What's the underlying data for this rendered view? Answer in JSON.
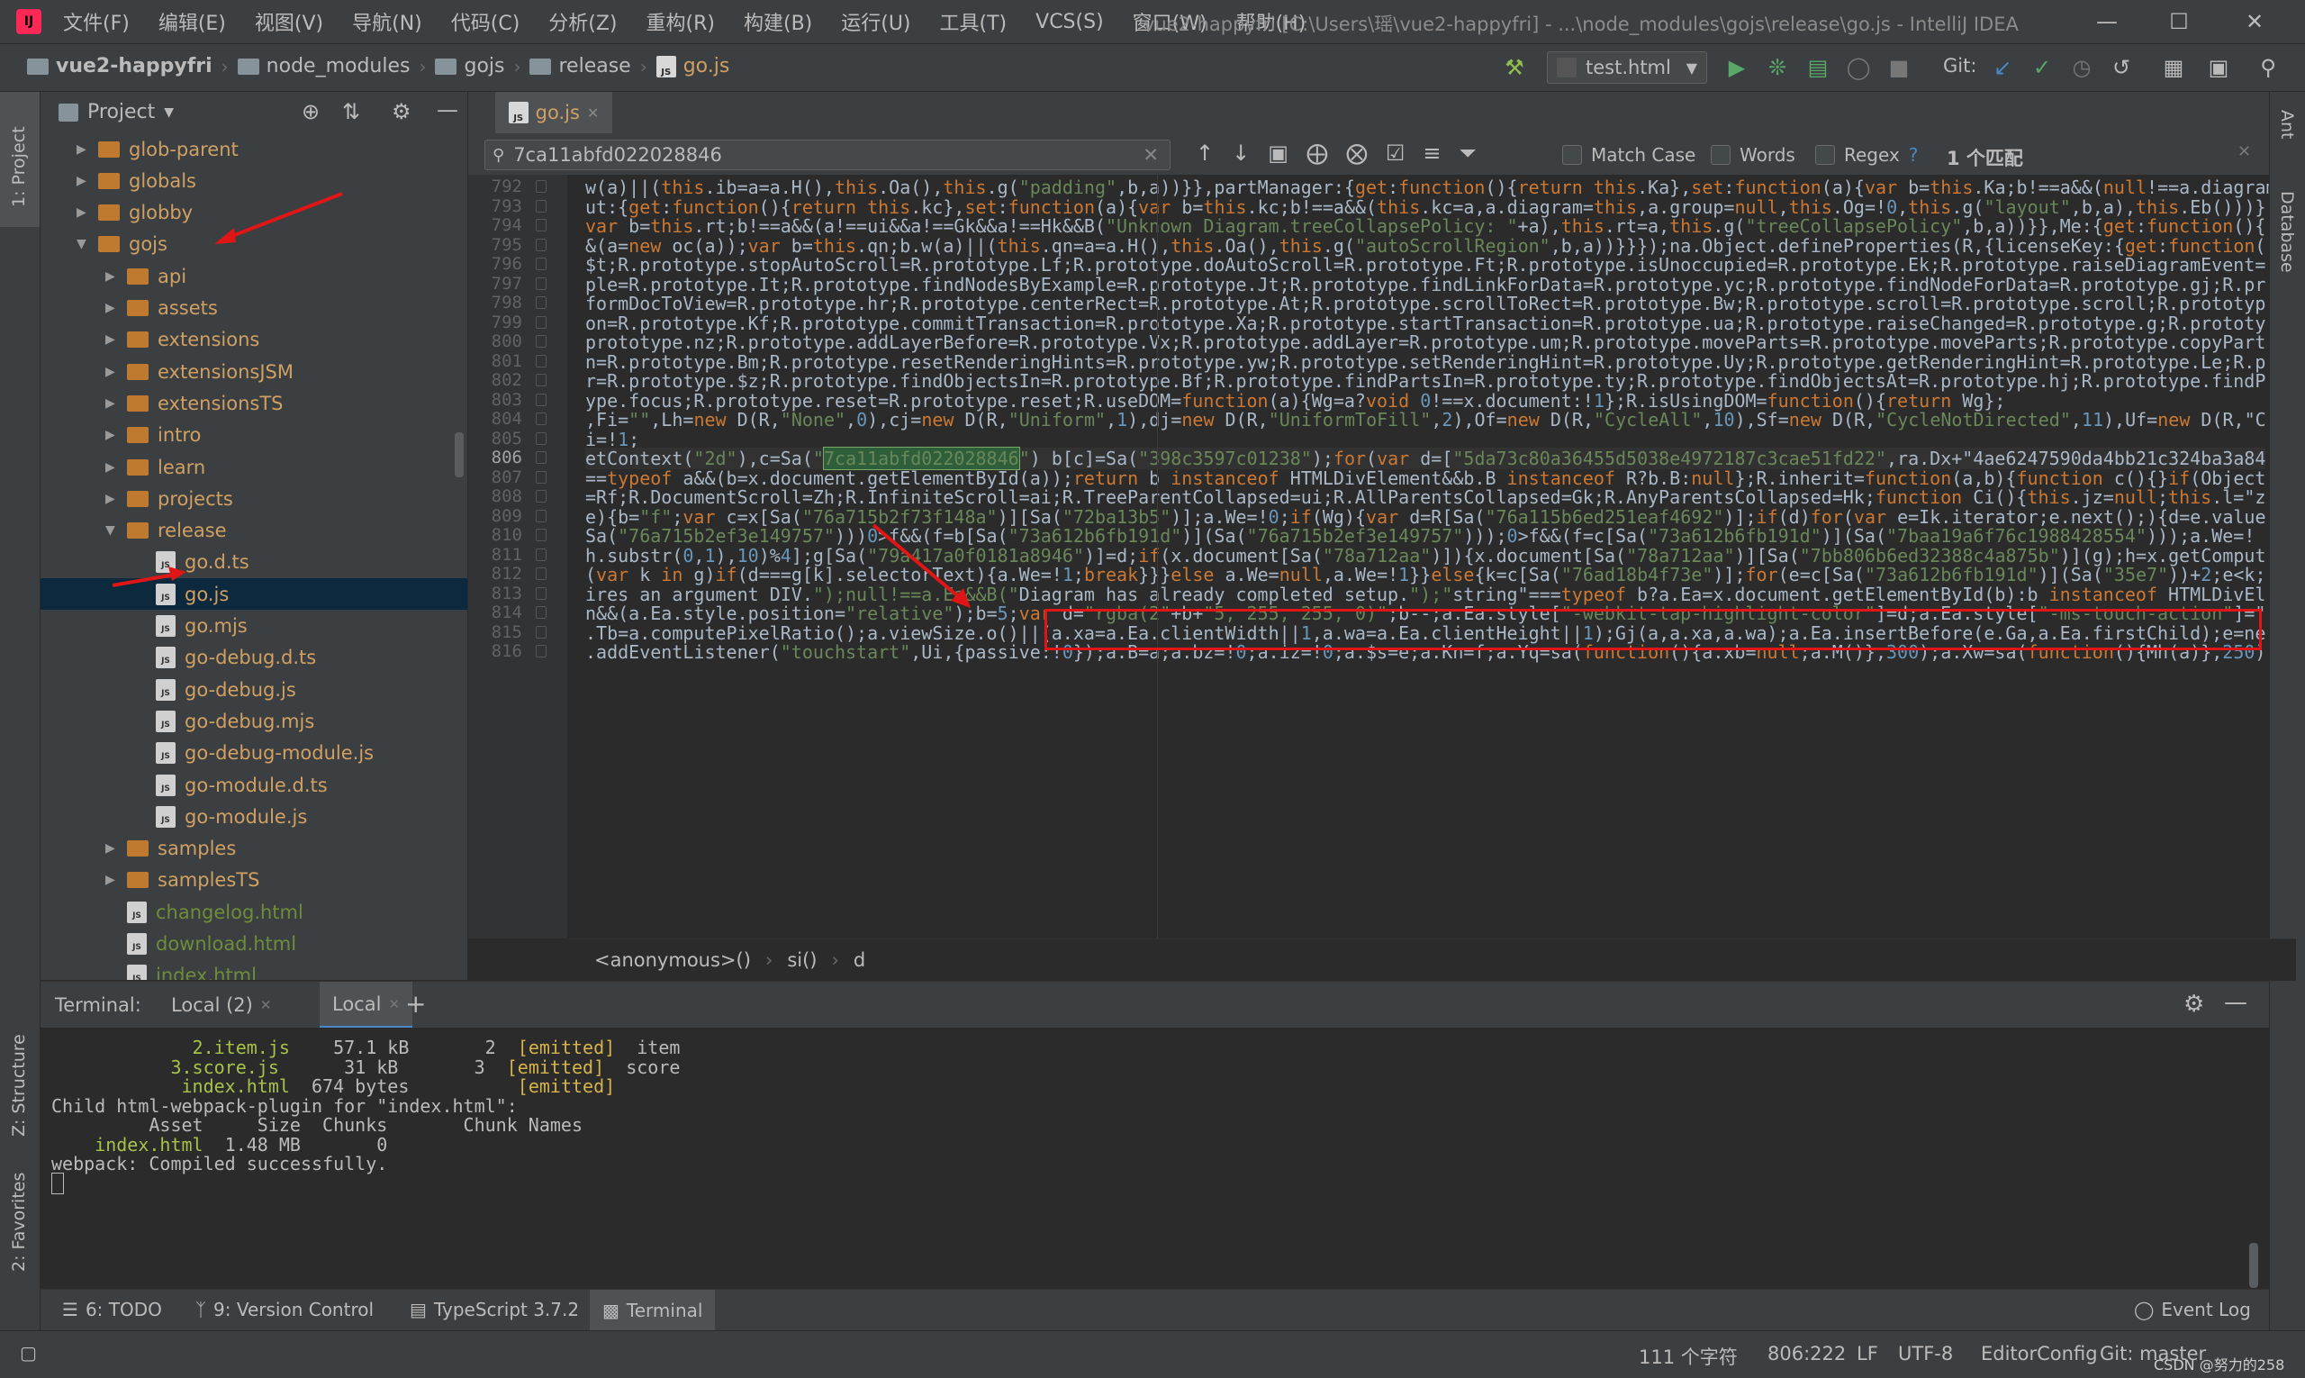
{
  "window": {
    "menu": [
      "文件(F)",
      "编辑(E)",
      "视图(V)",
      "导航(N)",
      "代码(C)",
      "分析(Z)",
      "重构(R)",
      "构建(B)",
      "运行(U)",
      "工具(T)",
      "VCS(S)",
      "窗口(W)",
      "帮助(H)"
    ],
    "title": "vue2-happyfri [C:\\Users\\瑶\\vue2-happyfri] - ...\\node_modules\\gojs\\release\\go.js - IntelliJ IDEA"
  },
  "navbar": {
    "breadcrumb": [
      "vue2-happyfri",
      "node_modules",
      "gojs",
      "release",
      "go.js"
    ],
    "run_config": "test.html",
    "git_label": "Git:"
  },
  "left_stripe": {
    "project_tab": "1: Project",
    "structure_tab": "Z: Structure",
    "favorites_tab": "2: Favorites"
  },
  "right_stripe": {
    "ant_tab": "Ant",
    "database_tab": "Database"
  },
  "project_panel": {
    "title": "Project",
    "tree": [
      {
        "label": "glob-parent",
        "type": "folder-orange",
        "depth": 0,
        "expanded": false
      },
      {
        "label": "globals",
        "type": "folder-orange",
        "depth": 0,
        "expanded": false
      },
      {
        "label": "globby",
        "type": "folder-orange",
        "depth": 0,
        "expanded": false
      },
      {
        "label": "gojs",
        "type": "folder-orange",
        "depth": 0,
        "expanded": true
      },
      {
        "label": "api",
        "type": "folder-orange",
        "depth": 1,
        "expanded": false
      },
      {
        "label": "assets",
        "type": "folder-orange",
        "depth": 1,
        "expanded": false
      },
      {
        "label": "extensions",
        "type": "folder-orange",
        "depth": 1,
        "expanded": false
      },
      {
        "label": "extensionsJSM",
        "type": "folder-orange",
        "depth": 1,
        "expanded": false
      },
      {
        "label": "extensionsTS",
        "type": "folder-orange",
        "depth": 1,
        "expanded": false
      },
      {
        "label": "intro",
        "type": "folder-orange",
        "depth": 1,
        "expanded": false
      },
      {
        "label": "learn",
        "type": "folder-orange",
        "depth": 1,
        "expanded": false
      },
      {
        "label": "projects",
        "type": "folder-orange",
        "depth": 1,
        "expanded": false
      },
      {
        "label": "release",
        "type": "folder-orange",
        "depth": 1,
        "expanded": true
      },
      {
        "label": "go.d.ts",
        "type": "file",
        "depth": 2
      },
      {
        "label": "go.js",
        "type": "file",
        "depth": 2,
        "selected": true
      },
      {
        "label": "go.mjs",
        "type": "file",
        "depth": 2
      },
      {
        "label": "go-debug.d.ts",
        "type": "file",
        "depth": 2
      },
      {
        "label": "go-debug.js",
        "type": "file",
        "depth": 2
      },
      {
        "label": "go-debug.mjs",
        "type": "file",
        "depth": 2
      },
      {
        "label": "go-debug-module.js",
        "type": "file",
        "depth": 2
      },
      {
        "label": "go-module.d.ts",
        "type": "file",
        "depth": 2
      },
      {
        "label": "go-module.js",
        "type": "file",
        "depth": 2
      },
      {
        "label": "samples",
        "type": "folder-orange",
        "depth": 1,
        "expanded": false
      },
      {
        "label": "samplesTS",
        "type": "folder-orange",
        "depth": 1,
        "expanded": false
      },
      {
        "label": "changelog.html",
        "type": "file",
        "depth": 1
      },
      {
        "label": "download.html",
        "type": "file",
        "depth": 1
      },
      {
        "label": "index.html",
        "type": "file",
        "depth": 1
      }
    ]
  },
  "editor": {
    "tab": "go.js",
    "search": {
      "query": "7ca11abfd022028846",
      "match_case": "Match Case",
      "words": "Words",
      "regex": "Regex",
      "regex_help": "?",
      "result": "1 个匹配"
    },
    "lines": [
      {
        "n": "792",
        "text": "w(a)||(this.ib=a=a.H(),this.Oa(),this.g(\"padding\",b,a))}},partManager:{get:function(){return this.Ka},set:function(a){var b=this.Ka;b!==a&&(null!==a.diagram"
      },
      {
        "n": "793",
        "text": "ut:{get:function(){return this.kc},set:function(a){var b=this.kc;b!==a&&(this.kc=a,a.diagram=this,a.group=null,this.Og=!0,this.g(\"layout\",b,a),this.Eb()))}"
      },
      {
        "n": "794",
        "text": "var b=this.rt;b!==a&&(a!==ui&&a!==Gk&&a!==Hk&&B(\"Unknown Diagram.treeCollapsePolicy: \"+a),this.rt=a,this.g(\"treeCollapsePolicy\",b,a))}},Me:{get:function(){"
      },
      {
        "n": "795",
        "text": "&(a=new oc(a));var b=this.qn;b.w(a)||(this.qn=a=a.H(),this.Oa(),this.g(\"autoScrollRegion\",b,a))}}});na.Object.defineProperties(R,{licenseKey:{get:function("
      },
      {
        "n": "796",
        "text": "$t;R.prototype.stopAutoScroll=R.prototype.Lf;R.prototype.doAutoScroll=R.prototype.Ft;R.prototype.isUnoccupied=R.prototype.Ek;R.prototype.raiseDiagramEvent="
      },
      {
        "n": "797",
        "text": "ple=R.prototype.It;R.prototype.findNodesByExample=R.prototype.Jt;R.prototype.findLinkForData=R.prototype.yc;R.prototype.findNodeForData=R.prototype.gj;R.pr"
      },
      {
        "n": "798",
        "text": "formDocToView=R.prototype.hr;R.prototype.centerRect=R.prototype.At;R.prototype.scrollToRect=R.prototype.Bw;R.prototype.scroll=R.prototype.scroll;R.prototyp"
      },
      {
        "n": "799",
        "text": "on=R.prototype.Kf;R.prototype.commitTransaction=R.prototype.Xa;R.prototype.startTransaction=R.prototype.ua;R.prototype.raiseChanged=R.prototype.g;R.prototy"
      },
      {
        "n": "800",
        "text": "prototype.nz;R.prototype.addLayerBefore=R.prototype.Vx;R.prototype.addLayer=R.prototype.um;R.prototype.moveParts=R.prototype.moveParts;R.prototype.copyPart"
      },
      {
        "n": "801",
        "text": "n=R.prototype.Bm;R.prototype.resetRenderingHints=R.prototype.yw;R.prototype.setRenderingHint=R.prototype.Uy;R.prototype.getRenderingHint=R.prototype.Le;R.p"
      },
      {
        "n": "802",
        "text": "r=R.prototype.$z;R.prototype.findObjectsIn=R.prototype.Bf;R.prototype.findPartsIn=R.prototype.ty;R.prototype.findObjectsAt=R.prototype.hj;R.prototype.findP"
      },
      {
        "n": "803",
        "text": "ype.focus;R.prototype.reset=R.prototype.reset;R.useDOM=function(a){Wg=a?void 0!==x.document:!1};R.isUsingDOM=function(){return Wg};"
      },
      {
        "n": "804",
        "text": ",Fi=\"\",Lh=new D(R,\"None\",0),cj=new D(R,\"Uniform\",1),dj=new D(R,\"UniformToFill\",2),Of=new D(R,\"CycleAll\",10),Sf=new D(R,\"CycleNotDirected\",11),Uf=new D(R,\"C"
      },
      {
        "n": "805",
        "text": "i=!1;"
      },
      {
        "n": "806",
        "text": "etContext(\"2d\"),c=Sa(\"7ca11abfd022028846\") b[c]=Sa(\"398c3597c01238\");for(var d=[\"5da73c80a36455d5038e4972187c3cae51fd22\",ra.Dx+\"4ae6247590da4bb21c324ba3a84"
      },
      {
        "n": "807",
        "text": "==typeof a&&(b=x.document.getElementById(a));return b instanceof HTMLDivElement&&b.B instanceof R?b.B:null};R.inherit=function(a,b){function c(){}if(Object"
      },
      {
        "n": "808",
        "text": "=Rf;R.DocumentScroll=Zh;R.InfiniteScroll=ai;R.TreeParentCollapsed=ui;R.AllParentsCollapsed=Gk;R.AnyParentsCollapsed=Hk;function Ci(){this.jz=null;this.l=\"z"
      },
      {
        "n": "809",
        "text": "e){b=\"f\";var c=x[Sa(\"76a715b2f73f148a\")][Sa(\"72ba13b5\")];a.We=!0;if(Wg){var d=R[Sa(\"76a115b6ed251eaf4692\")];if(d)for(var e=Ik.iterator;e.next();){d=e.value"
      },
      {
        "n": "810",
        "text": "Sa(\"76a715b2ef3e149757\")))0>f&&(f=b[Sa(\"73a612b6fb191d\")](Sa(\"76a715b2ef3e149757\")));0>f&&(f=c[Sa(\"73a612b6fb191d\")](Sa(\"7baa19a6f76c1988428554\")));a.We=!"
      },
      {
        "n": "811",
        "text": "h.substr(0,1),10)%4];g[Sa(\"79a417a0f0181a8946\")]=d;if(x.document[Sa(\"78a712aa\")]){x.document[Sa(\"78a712aa\")][Sa(\"7bb806b6ed32388c4a875b\")](g);h=x.getComput"
      },
      {
        "n": "812",
        "text": "(var k in g)if(d===g[k].selectorText){a.We=!1;break}}}else a.We=null,a.We=!1}}else{k=c[Sa(\"76ad18b4f73e\")];for(e=c[Sa(\"73a612b6fb191d\")](Sa(\"35e7\"))+2;e<k;"
      },
      {
        "n": "813",
        "text": "ires an argument DIV.\");null!==a.Ea&&B(\"Diagram has already completed setup.\");\"string\"===typeof b?a.Ea=x.document.getElementById(b):b instanceof HTMLDivEl"
      },
      {
        "n": "814",
        "text": "n&&(a.Ea.style.position=\"relative\");b=5;var d=\"rgba(2\"+b+\"5, 255, 255, 0)\";b--;a.Ea.style[\"-webkit-tap-highlight-color\"]=d;a.Ea.style[\"-ms-touch-action\"]=\""
      },
      {
        "n": "815",
        "text": ".Tb=a.computePixelRatio();a.viewSize.o()||(a.xa=a.Ea.clientWidth||1,a.wa=a.Ea.clientHeight||1);Gj(a,a.xa,a.wa);a.Ea.insertBefore(e.Ga,a.Ea.firstChild);e=ne"
      },
      {
        "n": "816",
        "text": ".addEventListener(\"touchstart\",Ui,{passive:!0});a.B=a;a.bz=!0;a.iz=!0;a.$s=e;a.Kn=f;a.Yq=sa(function(){a.xb=null;a.M()},300);a.Xw=sa(function(){Mh(a)},250)"
      }
    ],
    "current_line": "806",
    "breadcrumb_footer": [
      "<anonymous>()",
      "si()",
      "d"
    ]
  },
  "terminal": {
    "label": "Terminal:",
    "tabs": [
      "Local (2)",
      "Local"
    ],
    "lines": [
      {
        "pre": "             ",
        "file": "2.item.js",
        "mid": "    57.1 kB       2  ",
        "tag": "[emitted]",
        "post": "  item"
      },
      {
        "pre": "           ",
        "file": "3.score.js",
        "mid": "      31 kB       3  ",
        "tag": "[emitted]",
        "post": "  score"
      },
      {
        "pre": "            ",
        "file": "index.html",
        "mid": "  674 bytes          ",
        "tag": "[emitted]",
        "post": ""
      },
      {
        "plain": "Child html-webpack-plugin for \"index.html\":"
      },
      {
        "plain": "         Asset     Size  Chunks       Chunk Names"
      },
      {
        "pre": "    ",
        "file": "index.html",
        "mid": "  1.48 MB       0",
        "tag": "",
        "post": ""
      },
      {
        "plain": "webpack: Compiled successfully."
      }
    ]
  },
  "bottom_tabs": [
    "6: TODO",
    "9: Version Control",
    "TypeScript 3.7.2",
    "Terminal"
  ],
  "event_log": "Event Log",
  "status": {
    "chars": "111 个字符",
    "position": "806:222",
    "line_sep": "LF",
    "encoding": "UTF-8",
    "editorconfig": "EditorConfig",
    "git": "Git: master",
    "watermark": "CSDN @努力的258"
  }
}
